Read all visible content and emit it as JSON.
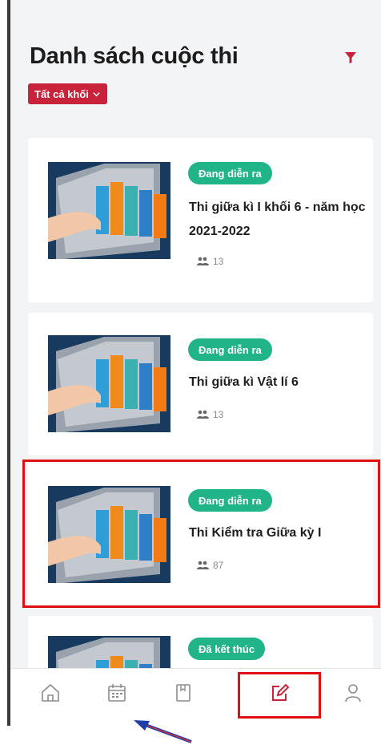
{
  "header": {
    "title": "Danh sách cuộc thi",
    "grade_filter_label": "Tất cả khối"
  },
  "contests": [
    {
      "status": "Đang diễn ra",
      "title": "Thi giữa kì I khối 6 - năm học 2021-2022",
      "participants": "13"
    },
    {
      "status": "Đang diễn ra",
      "title": "Thi giữa kì Vật lí 6",
      "participants": "13"
    },
    {
      "status": "Đang diễn ra",
      "title": "Thi Kiểm tra Giữa kỳ I",
      "participants": "87"
    },
    {
      "status": "Đã kết thúc"
    }
  ],
  "nav": {
    "items": [
      "home-icon",
      "calendar-icon",
      "book-icon",
      "edit-icon",
      "user-icon"
    ],
    "active": "edit-icon"
  },
  "colors": {
    "accent": "#c8233a",
    "status_ongoing": "#22b489",
    "highlight_box": "#e01010",
    "arrow": "#1f3fa8"
  }
}
